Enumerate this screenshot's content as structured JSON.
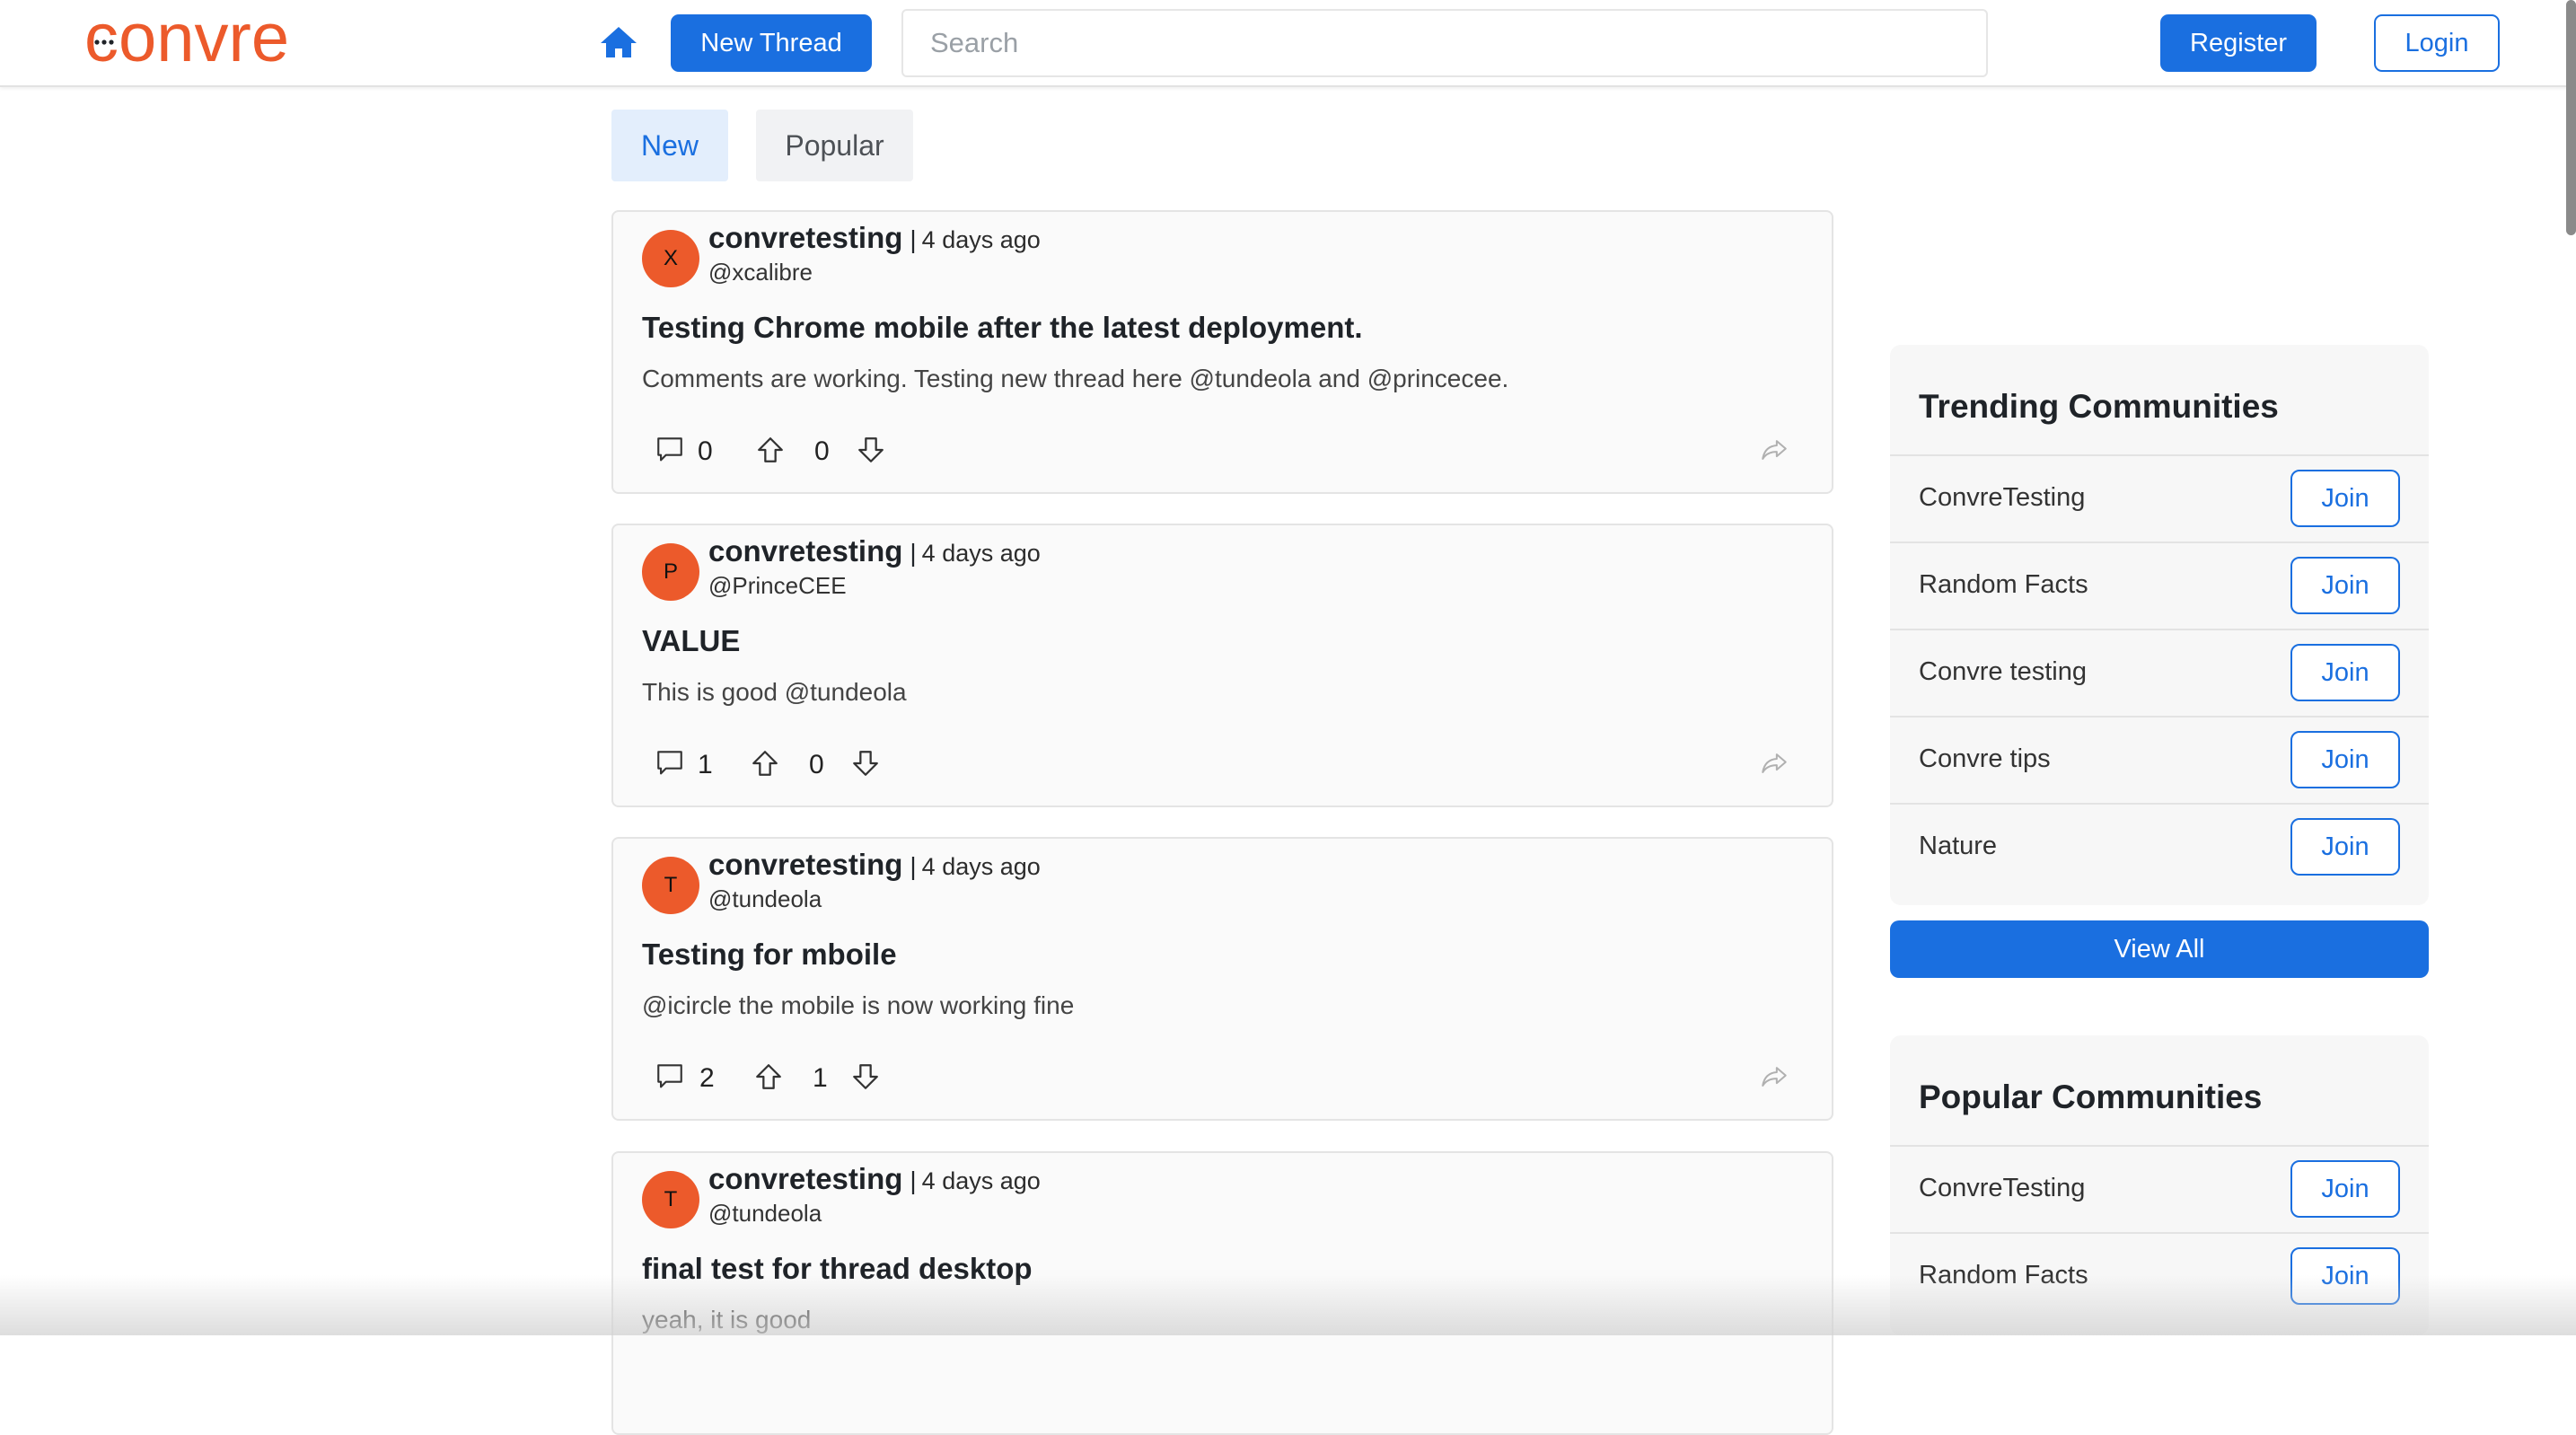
{
  "header": {
    "logo_text": "convre",
    "home_icon": "home-icon",
    "new_thread_label": "New Thread",
    "search_placeholder": "Search",
    "register_label": "Register",
    "login_label": "Login",
    "colors": {
      "brand": "#ec5a2b",
      "accent": "#1a6fe0"
    }
  },
  "tabs": [
    {
      "label": "New",
      "active": true
    },
    {
      "label": "Popular",
      "active": false
    }
  ],
  "threads": [
    {
      "avatar": "X",
      "author": "convretesting",
      "separator": "|",
      "time": "4 days ago",
      "handle": "@xcalibre",
      "title": "Testing Chrome mobile after the latest deployment.",
      "body": "Comments are working. Testing new thread here @tundeola and @princecee.",
      "comments": "0",
      "votes": "0"
    },
    {
      "avatar": "P",
      "author": "convretesting",
      "separator": "|",
      "time": "4 days ago",
      "handle": "@PrinceCEE",
      "title": "VALUE",
      "body": "This is good @tundeola",
      "comments": "1",
      "votes": "0"
    },
    {
      "avatar": "T",
      "author": "convretesting",
      "separator": "|",
      "time": "4 days ago",
      "handle": "@tundeola",
      "title": "Testing for mboile",
      "body": "@icircle the mobile is now working fine",
      "comments": "2",
      "votes": "1"
    },
    {
      "avatar": "T",
      "author": "convretesting",
      "separator": "|",
      "time": "4 days ago",
      "handle": "@tundeola",
      "title": "final test for thread desktop",
      "body": "yeah, it is good",
      "comments": "",
      "votes": ""
    }
  ],
  "trending": {
    "title": "Trending Communities",
    "join_label": "Join",
    "items": [
      "ConvreTesting",
      "Random Facts",
      "Convre testing",
      "Convre tips",
      "Nature"
    ],
    "view_all_label": "View All"
  },
  "popular": {
    "title": "Popular Communities",
    "join_label": "Join",
    "items": [
      "ConvreTesting",
      "Random Facts"
    ]
  }
}
